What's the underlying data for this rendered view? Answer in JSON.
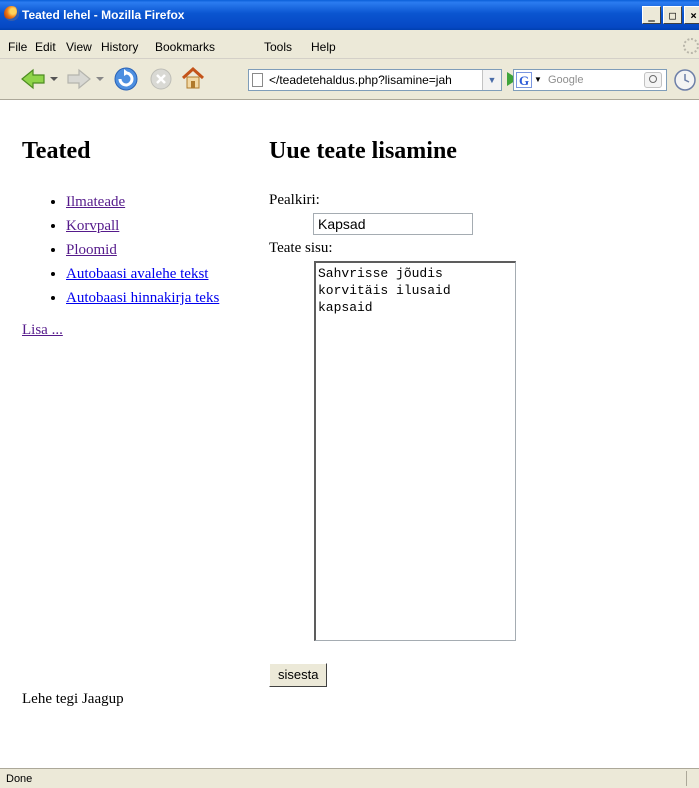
{
  "window": {
    "title": "Teated lehel - Mozilla Firefox",
    "buttons": [
      "_",
      "□",
      "×"
    ]
  },
  "menubar": {
    "items": [
      "File",
      "Edit",
      "View",
      "History",
      "Bookmarks",
      "Tools",
      "Help"
    ]
  },
  "toolbar": {
    "url": "</teadetehaldus.php?lisamine=jah",
    "search_placeholder": "Google"
  },
  "sidebar": {
    "heading": "Teated",
    "items": [
      {
        "label": "Ilmateade",
        "visited": true
      },
      {
        "label": "Korvpall",
        "visited": true
      },
      {
        "label": "Ploomid",
        "visited": true
      },
      {
        "label": "Autobaasi avalehe tekst",
        "visited": false
      },
      {
        "label": "Autobaasi hinnakirja teks",
        "visited": false
      }
    ],
    "add_link": "Lisa ..."
  },
  "form": {
    "heading": "Uue teate lisamine",
    "title_label": "Pealkiri:",
    "title_value": "Kapsad",
    "body_label": "Teate sisu:",
    "body_value": "Sahvrisse jõudis\nkorvitäis ilusaid\nkapsaid",
    "submit_label": "sisesta"
  },
  "footer": {
    "text": "Lehe tegi Jaagup"
  },
  "status": {
    "text": "Done"
  }
}
